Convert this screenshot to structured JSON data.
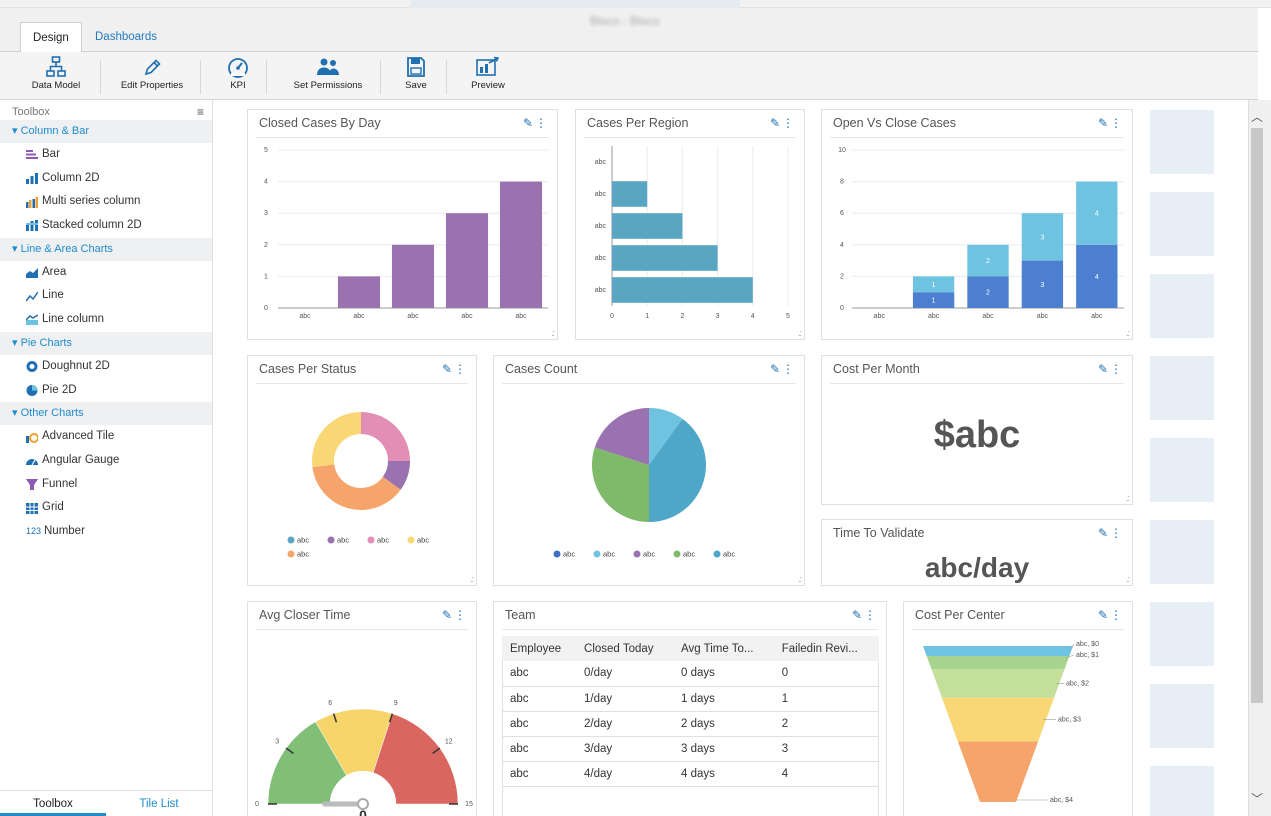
{
  "window": {
    "doc_title": "Bisco - Bisco"
  },
  "tabs": [
    {
      "label": "Design"
    },
    {
      "label": "Dashboards"
    }
  ],
  "ribbon": [
    {
      "label": "Data Model",
      "icon": "data-model-icon"
    },
    {
      "label": "Edit Properties",
      "icon": "pencil-icon"
    },
    {
      "label": "KPI",
      "icon": "gauge-icon"
    },
    {
      "label": "Set Permissions",
      "icon": "users-icon"
    },
    {
      "label": "Save",
      "icon": "save-icon"
    },
    {
      "label": "Preview",
      "icon": "preview-icon"
    }
  ],
  "toolbox": {
    "title": "Toolbox",
    "groups": [
      {
        "label": "Column & Bar",
        "items": [
          "Bar",
          "Column 2D",
          "Multi series column",
          "Stacked column 2D"
        ]
      },
      {
        "label": "Line & Area Charts",
        "items": [
          "Area",
          "Line",
          "Line column"
        ]
      },
      {
        "label": "Pie Charts",
        "items": [
          "Doughnut 2D",
          "Pie 2D"
        ]
      },
      {
        "label": "Other Charts",
        "items": [
          "Advanced Tile",
          "Angular Gauge",
          "Funnel",
          "Grid",
          "Number"
        ]
      }
    ],
    "number_icon_text": "123",
    "bottom_tabs": [
      "Toolbox",
      "Tile List"
    ]
  },
  "colors": {
    "accent": "#1f8ccd",
    "purple": "#9b72b0",
    "teal": "#5aa6c2",
    "blue": "#4c7fcf",
    "lightblue": "#6ec3e0"
  },
  "tiles": {
    "closed_by_day": {
      "title": "Closed Cases By Day"
    },
    "per_region": {
      "title": "Cases Per Region"
    },
    "open_vs_close": {
      "title": "Open Vs Close Cases"
    },
    "per_status": {
      "title": "Cases Per Status"
    },
    "cases_count": {
      "title": "Cases Count"
    },
    "cost_month": {
      "title": "Cost Per Month",
      "value": "$abc"
    },
    "time_validate": {
      "title": "Time To Validate",
      "value": "abc/day"
    },
    "closer_time": {
      "title": "Avg Closer Time"
    },
    "team": {
      "title": "Team"
    },
    "cost_center": {
      "title": "Cost Per Center"
    }
  },
  "team_table": {
    "headers": [
      "Employee",
      "Closed Today",
      "Avg Time To...",
      "Failedin Revi..."
    ],
    "rows": [
      [
        "abc",
        "0/day",
        "0 days",
        "0"
      ],
      [
        "abc",
        "1/day",
        "1 days",
        "1"
      ],
      [
        "abc",
        "2/day",
        "2 days",
        "2"
      ],
      [
        "abc",
        "3/day",
        "3 days",
        "3"
      ],
      [
        "abc",
        "4/day",
        "4 days",
        "4"
      ]
    ]
  },
  "chart_data": [
    {
      "id": "closed_by_day",
      "type": "bar",
      "categories": [
        "abc",
        "abc",
        "abc",
        "abc",
        "abc"
      ],
      "values": [
        0,
        1,
        2,
        3,
        4
      ],
      "ylim": [
        0,
        5
      ],
      "yticks": [
        0,
        1,
        2,
        3,
        4,
        5
      ],
      "color": "#9b72b0"
    },
    {
      "id": "per_region",
      "type": "bar",
      "orientation": "horizontal",
      "categories": [
        "abc",
        "abc",
        "abc",
        "abc",
        "abc"
      ],
      "values": [
        0,
        1,
        2,
        3,
        4
      ],
      "xlim": [
        0,
        5
      ],
      "xticks": [
        0,
        1,
        2,
        3,
        4,
        5
      ],
      "color": "#5aa6c2"
    },
    {
      "id": "open_vs_close",
      "type": "bar",
      "stacked": true,
      "categories": [
        "abc",
        "abc",
        "abc",
        "abc",
        "abc"
      ],
      "ylim": [
        0,
        10
      ],
      "yticks": [
        0,
        2,
        4,
        6,
        8,
        10
      ],
      "series": [
        {
          "values": [
            0,
            1,
            2,
            3,
            4
          ],
          "color": "#4c7fcf"
        },
        {
          "values": [
            0,
            1,
            2,
            3,
            4
          ],
          "color": "#6ec3e0"
        }
      ]
    },
    {
      "id": "per_status",
      "type": "pie",
      "donut": true,
      "slices": [
        {
          "label": "abc",
          "value": 25,
          "color": "#e38fb5"
        },
        {
          "label": "abc",
          "value": 10,
          "color": "#9b72b0"
        },
        {
          "label": "abc",
          "value": 38,
          "color": "#f5a56b"
        },
        {
          "label": "abc",
          "value": 27,
          "color": "#f8d774"
        }
      ],
      "legend": [
        {
          "label": "abc",
          "color": "#5aa6c2"
        },
        {
          "label": "abc",
          "color": "#9b72b0"
        },
        {
          "label": "abc",
          "color": "#e38fb5"
        },
        {
          "label": "abc",
          "color": "#f8d774"
        },
        {
          "label": "abc",
          "color": "#f5a56b"
        }
      ]
    },
    {
      "id": "cases_count",
      "type": "pie",
      "slices": [
        {
          "label": "abc",
          "value": 10,
          "color": "#6ec3e0"
        },
        {
          "label": "abc",
          "value": 40,
          "color": "#4ea7c7"
        },
        {
          "label": "abc",
          "value": 30,
          "color": "#7fba6b"
        },
        {
          "label": "abc",
          "value": 20,
          "color": "#9b72b0"
        }
      ],
      "legend": [
        {
          "label": "abc",
          "color": "#3f6fc5"
        },
        {
          "label": "abc",
          "color": "#6ec3e0"
        },
        {
          "label": "abc",
          "color": "#9b72b0"
        },
        {
          "label": "abc",
          "color": "#7fba6b"
        },
        {
          "label": "abc",
          "color": "#4ea7c7"
        }
      ]
    },
    {
      "id": "closer_time",
      "type": "gauge",
      "min": 0,
      "max": 15,
      "ticks": [
        0,
        3,
        6,
        9,
        12,
        15
      ],
      "value": 0,
      "bands": [
        {
          "from": 0,
          "to": 5,
          "color": "#80bf75"
        },
        {
          "from": 5,
          "to": 9,
          "color": "#f7d56a"
        },
        {
          "from": 9,
          "to": 15,
          "color": "#d9675f"
        }
      ]
    },
    {
      "id": "cost_center",
      "type": "funnel",
      "stages": [
        {
          "label": "abc, $0",
          "color": "#6ec3e0"
        },
        {
          "label": "abc, $1",
          "color": "#a6d48e"
        },
        {
          "label": "abc, $2",
          "color": "#c4df9c"
        },
        {
          "label": "abc, $3",
          "color": "#f8d774"
        },
        {
          "label": "abc, $4",
          "color": "#f5a56b"
        }
      ]
    }
  ]
}
